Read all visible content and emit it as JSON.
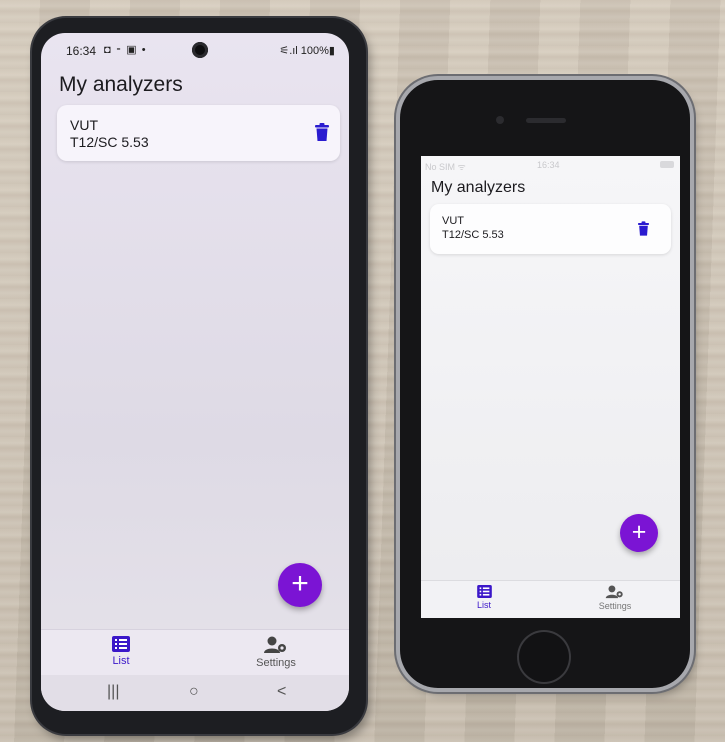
{
  "android": {
    "status": {
      "time": "16:34",
      "icons": "◘ ⁃ ▣ •",
      "battery": "⚟.ıl 100%▮"
    },
    "title": "My analyzers",
    "analyzer": {
      "name": "VUT",
      "version": "T12/SC 5.53"
    },
    "fab_label": "+",
    "nav": {
      "list": "List",
      "settings": "Settings"
    },
    "sysbar": {
      "recents": "|||",
      "home": "○",
      "back": "<"
    }
  },
  "iphone": {
    "status": {
      "carrier": "No SIM ᯤ",
      "time": "16:34"
    },
    "title": "My analyzers",
    "analyzer": {
      "name": "VUT",
      "version": "T12/SC 5.53"
    },
    "fab_label": "+",
    "nav": {
      "list": "List",
      "settings": "Settings"
    }
  },
  "colors": {
    "accent": "#7b14d4",
    "primary": "#3b17c9"
  },
  "icons": {
    "delete": "trash-icon",
    "list": "list-icon",
    "settings": "user-gear-icon",
    "add": "plus-icon"
  }
}
